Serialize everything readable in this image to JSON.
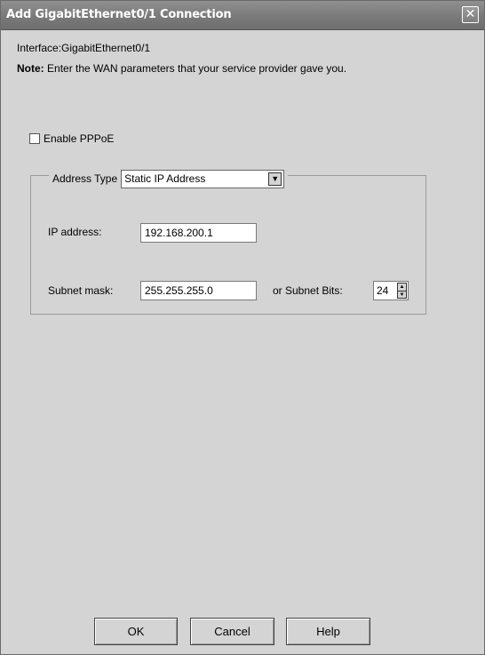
{
  "window": {
    "title": "Add GigabitEthernet0/1 Connection",
    "close_glyph": "✕"
  },
  "interface_label": "Interface:GigabitEthernet0/1",
  "note": {
    "prefix": "Note:",
    "text": "Enter the WAN parameters that your service provider gave you."
  },
  "pppoe": {
    "label": "Enable PPPoE",
    "checked": false
  },
  "address": {
    "type_label": "Address Type",
    "type_value": "Static IP Address",
    "ip_label": "IP address:",
    "ip_value": "192.168.200.1",
    "mask_label": "Subnet mask:",
    "mask_value": "255.255.255.0",
    "bits_label": "or Subnet Bits:",
    "bits_value": "24"
  },
  "buttons": {
    "ok": "OK",
    "cancel": "Cancel",
    "help": "Help"
  },
  "icons": {
    "dropdown": "chevron-down-icon",
    "spin_up": "triangle-up-icon",
    "spin_down": "triangle-down-icon"
  },
  "colors": {
    "titlebar": "#7f7f7f",
    "dialog_background": "#d4d4d4"
  }
}
